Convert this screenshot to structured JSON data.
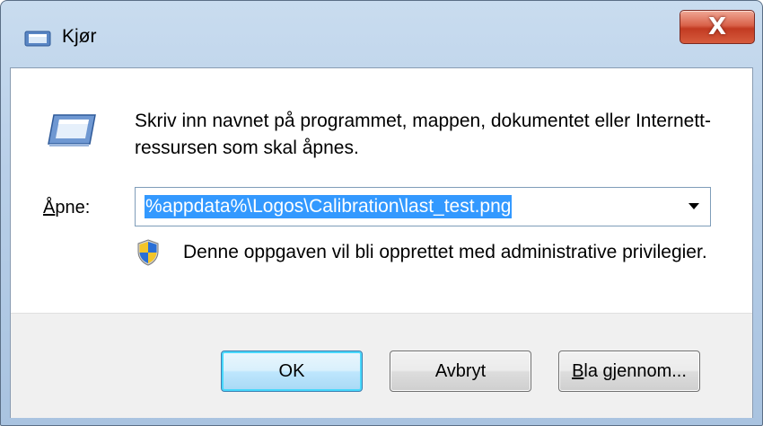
{
  "window": {
    "title": "Kjør",
    "close_glyph": "X",
    "title_icon": "run-icon"
  },
  "dialog": {
    "icon": "run-icon",
    "instructions": "Skriv inn navnet på programmet, mappen, dokumentet eller Internett-ressursen som skal åpnes.",
    "open_label_accesskey": "Å",
    "open_label_rest": "pne:",
    "open_value": "%appdata%\\Logos\\Calibration\\last_test.png",
    "admin_icon": "uac-shield-icon",
    "admin_note": "Denne oppgaven vil bli opprettet med administrative privilegier."
  },
  "buttons": {
    "ok": "OK",
    "cancel": "Avbryt",
    "browse_accesskey": "B",
    "browse_rest": "la gjennom..."
  },
  "colors": {
    "selection": "#3399ff",
    "close_button": "#c23b22",
    "window_frame": "#b8cfe8"
  }
}
